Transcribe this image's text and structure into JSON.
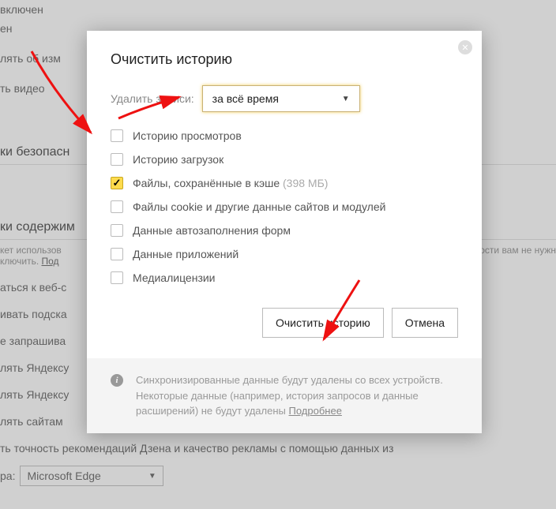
{
  "bg": {
    "line1": "включен",
    "line2": "ен",
    "line3": "лять об изм",
    "line4": "ть видео",
    "heading1": "ки безопасн",
    "heading2": "ки содержим",
    "note1_a": "кет использов",
    "note1_b": "жности вам не нужн",
    "note2_a": "ключить. ",
    "note2_link": "Под",
    "opt1": "аться к веб-с",
    "opt2": "ивать подска",
    "opt3": "е запрашива",
    "opt4": "лять Яндексу",
    "opt5": "лять Яндексу",
    "opt6": "лять сайтам",
    "bottom_line": "ть точность рекомендаций Дзена и качество рекламы с помощью данных из",
    "select_label": "ра:",
    "select_value": "Microsoft Edge"
  },
  "dialog": {
    "title": "Очистить историю",
    "delete_label": "Удалить записи:",
    "dropdown_value": "за всё время",
    "checks": [
      {
        "label": "Историю просмотров",
        "checked": false,
        "size": ""
      },
      {
        "label": "Историю загрузок",
        "checked": false,
        "size": ""
      },
      {
        "label": "Файлы, сохранённые в кэше",
        "checked": true,
        "size": " (398 МБ)"
      },
      {
        "label": "Файлы cookie и другие данные сайтов и модулей",
        "checked": false,
        "size": ""
      },
      {
        "label": "Данные автозаполнения форм",
        "checked": false,
        "size": ""
      },
      {
        "label": "Данные приложений",
        "checked": false,
        "size": ""
      },
      {
        "label": "Медиалицензии",
        "checked": false,
        "size": ""
      }
    ],
    "btn_clear": "Очистить историю",
    "btn_cancel": "Отмена",
    "footer_text": "Синхронизированные данные будут удалены со всех устройств. Некоторые данные (например, история запросов и данные расширений) не будут удалены ",
    "footer_link": "Подробнее"
  }
}
